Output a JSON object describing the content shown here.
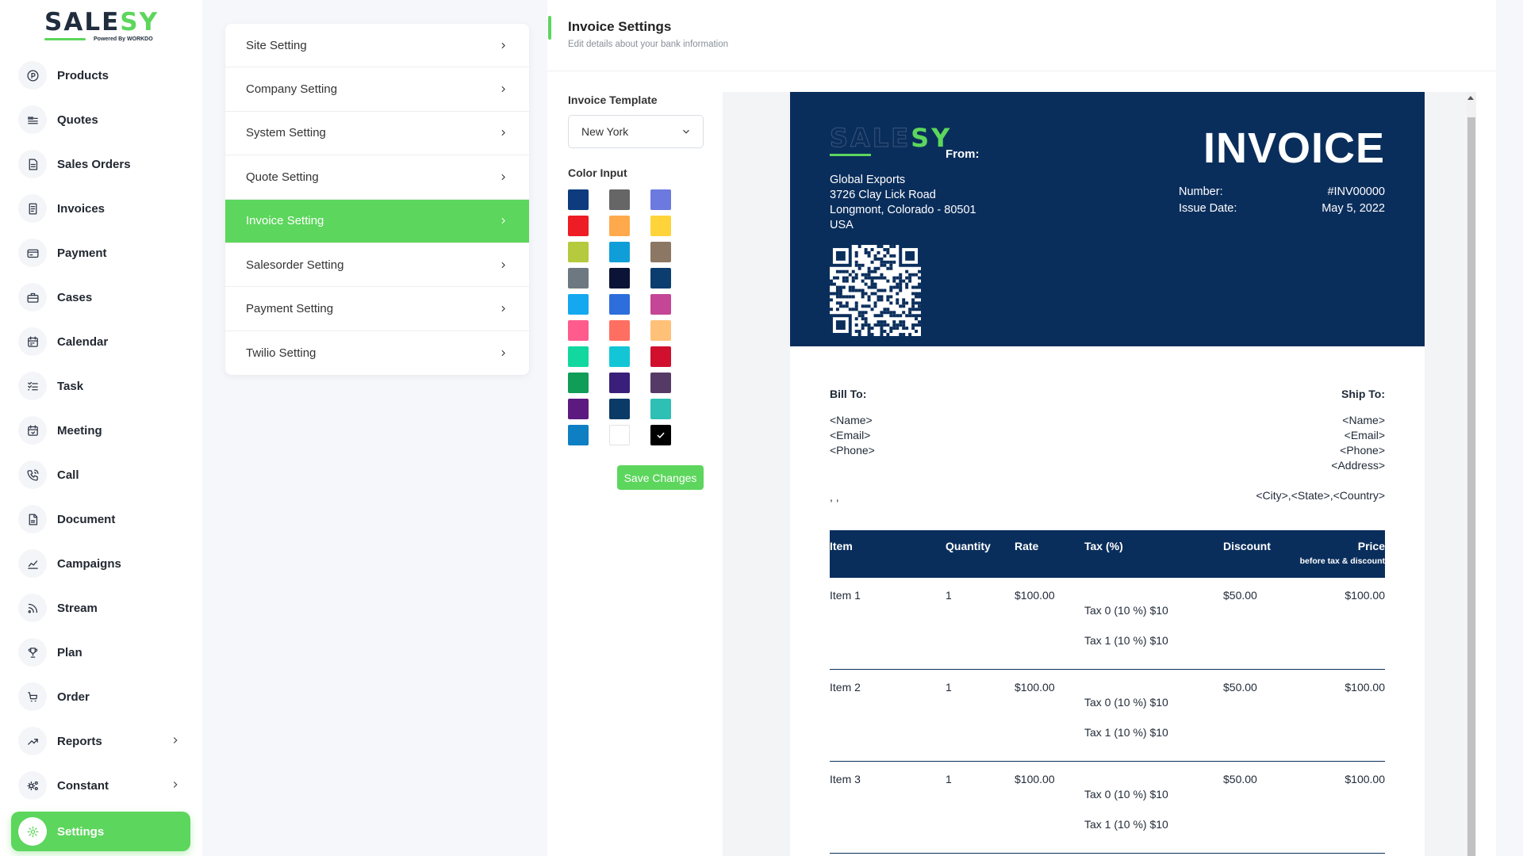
{
  "logo": {
    "brand_main": "SALE",
    "brand_accent": "SY",
    "tagline": "Powered By WORKDO"
  },
  "sidebar": {
    "items": [
      {
        "label": "Products",
        "icon": "products-icon"
      },
      {
        "label": "Quotes",
        "icon": "quotes-icon"
      },
      {
        "label": "Sales Orders",
        "icon": "sales-orders-icon"
      },
      {
        "label": "Invoices",
        "icon": "invoices-icon"
      },
      {
        "label": "Payment",
        "icon": "payment-icon"
      },
      {
        "label": "Cases",
        "icon": "cases-icon"
      },
      {
        "label": "Calendar",
        "icon": "calendar-icon"
      },
      {
        "label": "Task",
        "icon": "task-icon"
      },
      {
        "label": "Meeting",
        "icon": "meeting-icon"
      },
      {
        "label": "Call",
        "icon": "call-icon"
      },
      {
        "label": "Document",
        "icon": "document-icon"
      },
      {
        "label": "Campaigns",
        "icon": "campaigns-icon"
      },
      {
        "label": "Stream",
        "icon": "stream-icon"
      },
      {
        "label": "Plan",
        "icon": "plan-icon"
      },
      {
        "label": "Order",
        "icon": "order-icon"
      },
      {
        "label": "Reports",
        "icon": "reports-icon"
      },
      {
        "label": "Constant",
        "icon": "constant-icon"
      },
      {
        "label": "Settings",
        "icon": "settings-icon"
      }
    ]
  },
  "settings_menu": [
    "Site Setting",
    "Company Setting",
    "System Setting",
    "Quote Setting",
    "Invoice Setting",
    "Salesorder Setting",
    "Payment Setting",
    "Twilio Setting"
  ],
  "header": {
    "title": "Invoice Settings",
    "subtitle": "Edit details about your bank information"
  },
  "form": {
    "template_label": "Invoice Template",
    "template_value": "New York",
    "color_label": "Color Input",
    "save_label": "Save Changes"
  },
  "colors": [
    "#0d3b7d",
    "#666666",
    "#6c7ae0",
    "#ee1c24",
    "#ffa94d",
    "#ffd43b",
    "#b5ca3c",
    "#109ed8",
    "#8c7764",
    "#6e7881",
    "#0b1436",
    "#0b3d6e",
    "#14a8f0",
    "#2e6ddc",
    "#c54596",
    "#ff5c8d",
    "#ff6f61",
    "#ffc078",
    "#12d8a0",
    "#12c6d6",
    "#d1102e",
    "#0f9d58",
    "#3a1f7a",
    "#553a66",
    "#5c1a80",
    "#0a3a66",
    "#2ebfb5",
    "#0f7fc4",
    "#ffffff",
    "#000000"
  ],
  "selected_color": "#000000",
  "invoice": {
    "from_label": "From:",
    "address": [
      "Global Exports",
      "3726 Clay Lick Road",
      "Longmont, Colorado - 80501",
      "USA"
    ],
    "title": "INVOICE",
    "number_label": "Number:",
    "number_value": "#INV00000",
    "date_label": "Issue Date:",
    "date_value": "May 5, 2022",
    "bill_to": {
      "title": "Bill To:",
      "lines": [
        "<Name>",
        "<Email>",
        "<Phone>"
      ],
      "city": ", ,"
    },
    "ship_to": {
      "title": "Ship To:",
      "lines": [
        "<Name>",
        "<Email>",
        "<Phone>",
        "<Address>"
      ],
      "city": "<City>,<State>,<Country>"
    },
    "columns": {
      "item": "Item",
      "quantity": "Quantity",
      "rate": "Rate",
      "tax": "Tax (%)",
      "discount": "Discount",
      "price": "Price",
      "price_sub": "before tax & discount"
    },
    "rows": [
      {
        "item": "Item 1",
        "qty": "1",
        "rate": "$100.00",
        "tax0": "Tax 0  (10 %) $10",
        "tax1": "Tax 1  (10 %) $10",
        "discount": "$50.00",
        "price": "$100.00"
      },
      {
        "item": "Item 2",
        "qty": "1",
        "rate": "$100.00",
        "tax0": "Tax 0  (10 %) $10",
        "tax1": "Tax 1  (10 %) $10",
        "discount": "$50.00",
        "price": "$100.00"
      },
      {
        "item": "Item 3",
        "qty": "1",
        "rate": "$100.00",
        "tax0": "Tax 0  (10 %) $10",
        "tax1": "Tax 1  (10 %) $10",
        "discount": "$50.00",
        "price": "$100.00"
      }
    ]
  }
}
